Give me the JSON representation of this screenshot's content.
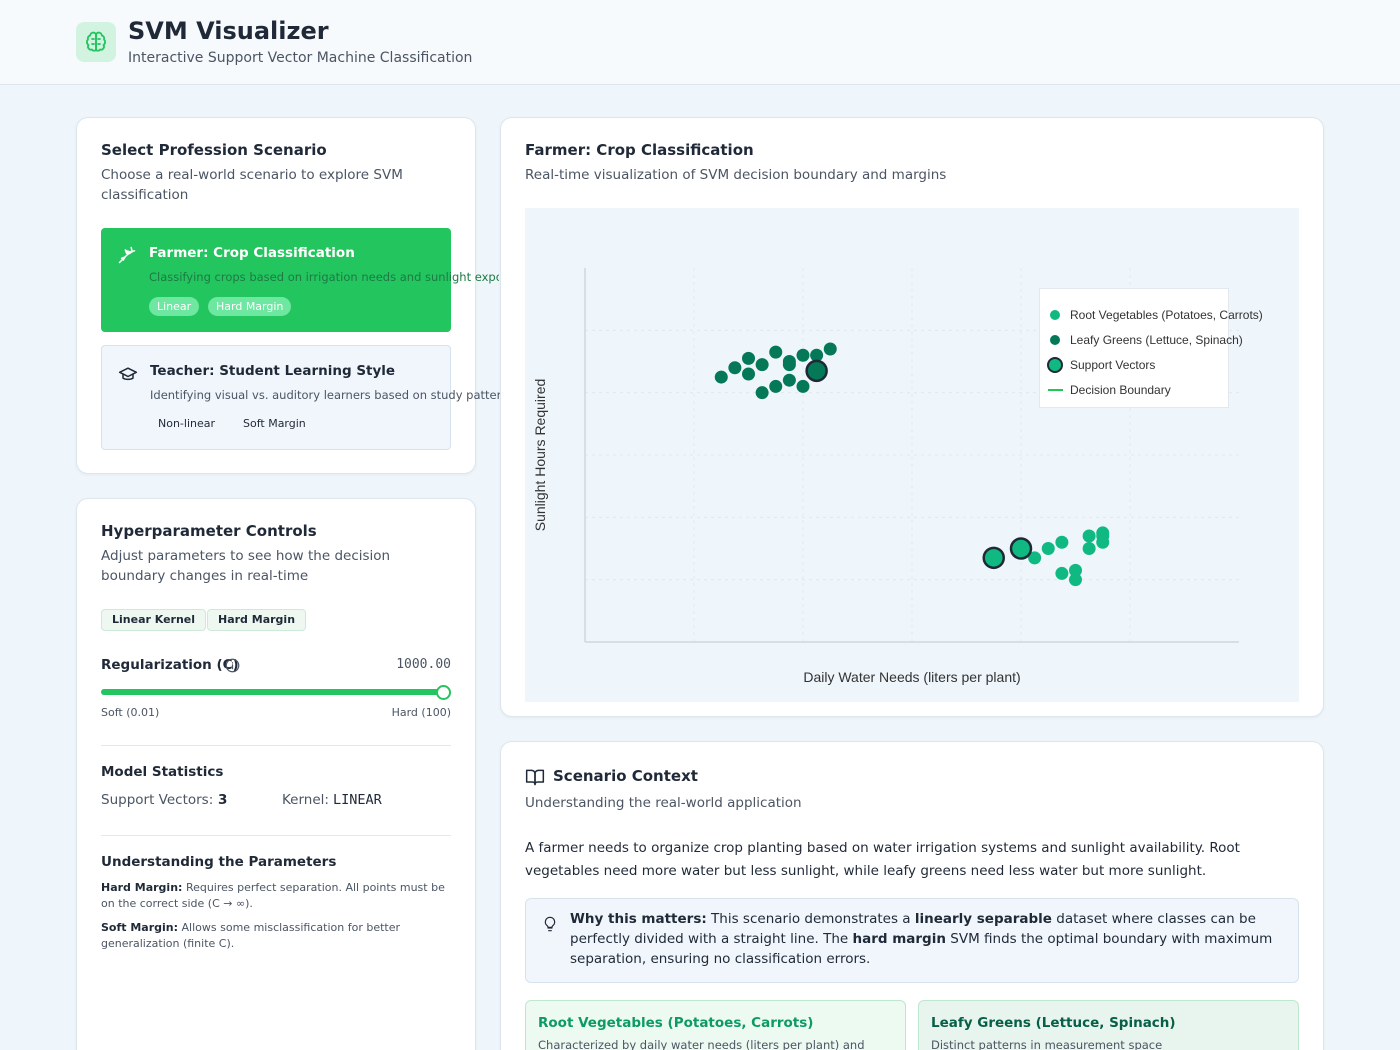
{
  "app": {
    "title": "SVM Visualizer",
    "subtitle": "Interactive Support Vector Machine Classification",
    "logo_icon": "brain-icon"
  },
  "scenario_panel": {
    "title": "Select Profession Scenario",
    "description": "Choose a real-world scenario to explore SVM classification",
    "scenarios": [
      {
        "icon": "wheat-icon",
        "title": "Farmer: Crop Classification",
        "description": "Classifying crops based on irrigation needs and sunlight exposure",
        "tags": [
          "Linear",
          "Hard Margin"
        ],
        "active": true
      },
      {
        "icon": "graduation-cap-icon",
        "title": "Teacher: Student Learning Style",
        "description": "Identifying visual vs. auditory learners based on study patterns",
        "tags": [
          "Non-linear",
          "Soft Margin"
        ],
        "active": false
      }
    ]
  },
  "hyperparams": {
    "title": "Hyperparameter Controls",
    "description": "Adjust parameters to see how the decision boundary changes in real-time",
    "tags": [
      "Linear Kernel",
      "Hard Margin"
    ],
    "regularization": {
      "label": "Regularization (C)",
      "value_text": "1000.00",
      "min_label": "Soft (0.01)",
      "max_label": "Hard (100)",
      "level_fraction": 1.0
    },
    "stats": {
      "title": "Model Statistics",
      "support_vectors_label": "Support Vectors:",
      "support_vectors_value": "3",
      "kernel_label": "Kernel:",
      "kernel_value": "LINEAR"
    },
    "understanding": {
      "title": "Understanding the Parameters",
      "hard_margin_term": "Hard Margin:",
      "hard_margin_text": "Requires perfect separation. All points must be on the correct side (C → ∞).",
      "soft_margin_term": "Soft Margin:",
      "soft_margin_text": "Allows some misclassification for better generalization (finite C)."
    }
  },
  "viz": {
    "title": "Farmer: Crop Classification",
    "description": "Real-time visualization of SVM decision boundary and margins"
  },
  "chart_data": {
    "type": "scatter",
    "xlabel": "Daily Water Needs (liters per plant)",
    "ylabel": "Sunlight Hours Required",
    "xlim": [
      0,
      12
    ],
    "ylim": [
      0,
      12
    ],
    "grid": true,
    "legend_position": "top-right",
    "legend": [
      {
        "label": "Root Vegetables (Potatoes, Carrots)",
        "kind": "point",
        "color": "#10b981"
      },
      {
        "label": "Leafy Greens (Lettuce, Spinach)",
        "kind": "point",
        "color": "#047857"
      },
      {
        "label": "Support Vectors",
        "kind": "support",
        "color": "#10b981"
      },
      {
        "label": "Decision Boundary",
        "kind": "line",
        "color": "#22c55e"
      }
    ],
    "series": [
      {
        "name": "Root Vegetables (Potatoes, Carrots)",
        "color": "#10b981",
        "x": [
          7.5,
          8.25,
          8.5,
          8.75,
          8.75,
          9.0,
          9.0,
          9.25,
          9.25,
          9.5,
          9.5,
          9.5
        ],
        "y": [
          2.7,
          2.7,
          3.0,
          3.2,
          2.2,
          2.0,
          2.3,
          3.0,
          3.4,
          3.2,
          3.5,
          3.4
        ]
      },
      {
        "name": "Leafy Greens (Lettuce, Spinach)",
        "color": "#047857",
        "x": [
          2.5,
          2.75,
          3.0,
          3.0,
          3.25,
          3.25,
          3.5,
          3.5,
          3.75,
          3.75,
          3.75,
          4.0,
          4.0,
          4.25,
          4.5
        ],
        "y": [
          8.5,
          8.8,
          8.6,
          9.1,
          8.0,
          8.9,
          9.3,
          8.2,
          8.4,
          9.0,
          8.9,
          8.2,
          9.2,
          9.2,
          9.4
        ]
      }
    ],
    "support_vectors": {
      "x": [
        4.25,
        7.5,
        8.0
      ],
      "y": [
        8.7,
        2.7,
        3.0
      ],
      "colors": [
        "#047857",
        "#10b981",
        "#10b981"
      ]
    }
  },
  "context": {
    "icon": "book-icon",
    "title": "Scenario Context",
    "description": "Understanding the real-world application",
    "body": "A farmer needs to organize crop planting based on water irrigation systems and sunlight availability. Root vegetables need more water but less sunlight, while leafy greens need less water but more sunlight.",
    "why_icon": "lightbulb-icon",
    "why_label": "Why this matters:",
    "why_text_1": " This scenario demonstrates a ",
    "why_bold_1": "linearly separable",
    "why_text_2": " dataset where classes can be perfectly divided with a straight line. The ",
    "why_bold_2": "hard margin",
    "why_text_3": " SVM finds the optimal boundary with maximum separation, ensuring no classification errors.",
    "class_cards": [
      {
        "title": "Root Vegetables (Potatoes, Carrots)",
        "text": "Characterized by daily water needs (liters per plant) and"
      },
      {
        "title": "Leafy Greens (Lettuce, Spinach)",
        "text": "Distinct patterns in measurement space"
      }
    ]
  }
}
